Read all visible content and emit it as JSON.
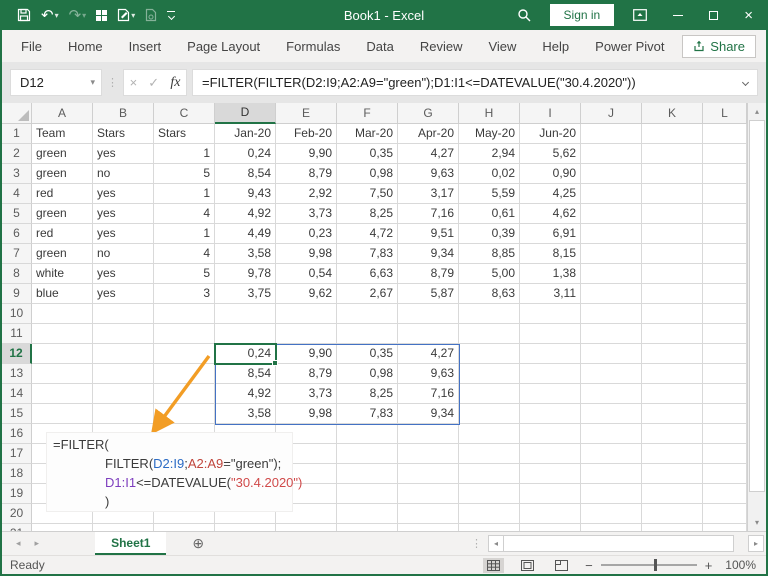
{
  "window": {
    "title": "Book1  -  Excel",
    "sign_in": "Sign in"
  },
  "colors": {
    "excel_green": "#217346",
    "spill_border": "#4472C4",
    "arrow_orange": "#F29D25",
    "gridline": "#D9D9D9"
  },
  "icons": {
    "quick_access": [
      "save",
      "undo",
      "redo",
      "grid-squares",
      "paste-edit",
      "document",
      "customize-toolbar"
    ],
    "titlebar_right": [
      "search",
      "ribbon-display-options",
      "minimize",
      "maximize",
      "close"
    ],
    "formula_bar": [
      "cancel",
      "enter",
      "insert-function",
      "expand-formula-bar"
    ],
    "status_views": [
      "normal-view",
      "page-layout-view",
      "page-break-view"
    ]
  },
  "ribbon": {
    "tabs": [
      "File",
      "Home",
      "Insert",
      "Page Layout",
      "Formulas",
      "Data",
      "Review",
      "View",
      "Help",
      "Power Pivot"
    ],
    "share": "Share"
  },
  "formula_bar": {
    "name_box": "D12",
    "formula": "=FILTER(FILTER(D2:I9;A2:A9=\"green\");D1:I1<=DATEVALUE(\"30.4.2020\"))"
  },
  "sheet": {
    "columns": [
      "A",
      "B",
      "C",
      "D",
      "E",
      "F",
      "G",
      "H",
      "I",
      "J",
      "K",
      "L"
    ],
    "visible_rows": 21,
    "selected_cell": {
      "col": "D",
      "row": 12
    },
    "spill_range": "D12:G15",
    "rows": [
      {
        "n": 1,
        "cells": [
          [
            "A",
            "Team",
            "l"
          ],
          [
            "B",
            "Stars",
            "l"
          ],
          [
            "C",
            "Stars",
            "l"
          ],
          [
            "D",
            "Jan-20",
            "r"
          ],
          [
            "E",
            "Feb-20",
            "r"
          ],
          [
            "F",
            "Mar-20",
            "r"
          ],
          [
            "G",
            "Apr-20",
            "r"
          ],
          [
            "H",
            "May-20",
            "r"
          ],
          [
            "I",
            "Jun-20",
            "r"
          ]
        ]
      },
      {
        "n": 2,
        "cells": [
          [
            "A",
            "green",
            "l"
          ],
          [
            "B",
            "yes",
            "l"
          ],
          [
            "C",
            "1",
            "r"
          ],
          [
            "D",
            "0,24",
            "r"
          ],
          [
            "E",
            "9,90",
            "r"
          ],
          [
            "F",
            "0,35",
            "r"
          ],
          [
            "G",
            "4,27",
            "r"
          ],
          [
            "H",
            "2,94",
            "r"
          ],
          [
            "I",
            "5,62",
            "r"
          ]
        ]
      },
      {
        "n": 3,
        "cells": [
          [
            "A",
            "green",
            "l"
          ],
          [
            "B",
            "no",
            "l"
          ],
          [
            "C",
            "5",
            "r"
          ],
          [
            "D",
            "8,54",
            "r"
          ],
          [
            "E",
            "8,79",
            "r"
          ],
          [
            "F",
            "0,98",
            "r"
          ],
          [
            "G",
            "9,63",
            "r"
          ],
          [
            "H",
            "0,02",
            "r"
          ],
          [
            "I",
            "0,90",
            "r"
          ]
        ]
      },
      {
        "n": 4,
        "cells": [
          [
            "A",
            "red",
            "l"
          ],
          [
            "B",
            "yes",
            "l"
          ],
          [
            "C",
            "1",
            "r"
          ],
          [
            "D",
            "9,43",
            "r"
          ],
          [
            "E",
            "2,92",
            "r"
          ],
          [
            "F",
            "7,50",
            "r"
          ],
          [
            "G",
            "3,17",
            "r"
          ],
          [
            "H",
            "5,59",
            "r"
          ],
          [
            "I",
            "4,25",
            "r"
          ]
        ]
      },
      {
        "n": 5,
        "cells": [
          [
            "A",
            "green",
            "l"
          ],
          [
            "B",
            "yes",
            "l"
          ],
          [
            "C",
            "4",
            "r"
          ],
          [
            "D",
            "4,92",
            "r"
          ],
          [
            "E",
            "3,73",
            "r"
          ],
          [
            "F",
            "8,25",
            "r"
          ],
          [
            "G",
            "7,16",
            "r"
          ],
          [
            "H",
            "0,61",
            "r"
          ],
          [
            "I",
            "4,62",
            "r"
          ]
        ]
      },
      {
        "n": 6,
        "cells": [
          [
            "A",
            "red",
            "l"
          ],
          [
            "B",
            "yes",
            "l"
          ],
          [
            "C",
            "1",
            "r"
          ],
          [
            "D",
            "4,49",
            "r"
          ],
          [
            "E",
            "0,23",
            "r"
          ],
          [
            "F",
            "4,72",
            "r"
          ],
          [
            "G",
            "9,51",
            "r"
          ],
          [
            "H",
            "0,39",
            "r"
          ],
          [
            "I",
            "6,91",
            "r"
          ]
        ]
      },
      {
        "n": 7,
        "cells": [
          [
            "A",
            "green",
            "l"
          ],
          [
            "B",
            "no",
            "l"
          ],
          [
            "C",
            "4",
            "r"
          ],
          [
            "D",
            "3,58",
            "r"
          ],
          [
            "E",
            "9,98",
            "r"
          ],
          [
            "F",
            "7,83",
            "r"
          ],
          [
            "G",
            "9,34",
            "r"
          ],
          [
            "H",
            "8,85",
            "r"
          ],
          [
            "I",
            "8,15",
            "r"
          ]
        ]
      },
      {
        "n": 8,
        "cells": [
          [
            "A",
            "white",
            "l"
          ],
          [
            "B",
            "yes",
            "l"
          ],
          [
            "C",
            "5",
            "r"
          ],
          [
            "D",
            "9,78",
            "r"
          ],
          [
            "E",
            "0,54",
            "r"
          ],
          [
            "F",
            "6,63",
            "r"
          ],
          [
            "G",
            "8,79",
            "r"
          ],
          [
            "H",
            "5,00",
            "r"
          ],
          [
            "I",
            "1,38",
            "r"
          ]
        ]
      },
      {
        "n": 9,
        "cells": [
          [
            "A",
            "blue",
            "l"
          ],
          [
            "B",
            "yes",
            "l"
          ],
          [
            "C",
            "3",
            "r"
          ],
          [
            "D",
            "3,75",
            "r"
          ],
          [
            "E",
            "9,62",
            "r"
          ],
          [
            "F",
            "2,67",
            "r"
          ],
          [
            "G",
            "5,87",
            "r"
          ],
          [
            "H",
            "8,63",
            "r"
          ],
          [
            "I",
            "3,11",
            "r"
          ]
        ]
      },
      {
        "n": 12,
        "cells": [
          [
            "D",
            "0,24",
            "r"
          ],
          [
            "E",
            "9,90",
            "r"
          ],
          [
            "F",
            "0,35",
            "r"
          ],
          [
            "G",
            "4,27",
            "r"
          ]
        ]
      },
      {
        "n": 13,
        "cells": [
          [
            "D",
            "8,54",
            "r"
          ],
          [
            "E",
            "8,79",
            "r"
          ],
          [
            "F",
            "0,98",
            "r"
          ],
          [
            "G",
            "9,63",
            "r"
          ]
        ]
      },
      {
        "n": 14,
        "cells": [
          [
            "D",
            "4,92",
            "r"
          ],
          [
            "E",
            "3,73",
            "r"
          ],
          [
            "F",
            "8,25",
            "r"
          ],
          [
            "G",
            "7,16",
            "r"
          ]
        ]
      },
      {
        "n": 15,
        "cells": [
          [
            "D",
            "3,58",
            "r"
          ],
          [
            "E",
            "9,98",
            "r"
          ],
          [
            "F",
            "7,83",
            "r"
          ],
          [
            "G",
            "9,34",
            "r"
          ]
        ]
      }
    ]
  },
  "annotation": {
    "colors": {
      "k": "#3b3b3b",
      "b": "#2B6BC4",
      "r": "#C0453C",
      "p": "#7D3DBE",
      "c": "#D04A4A"
    },
    "lines": [
      {
        "indent": 0,
        "segments": [
          {
            "t": "=FILTER(",
            "c": "k"
          }
        ]
      },
      {
        "indent": 1,
        "segments": [
          {
            "t": "FILTER(",
            "c": "k"
          },
          {
            "t": "D2:I9",
            "c": "b"
          },
          {
            "t": ";",
            "c": "k"
          },
          {
            "t": "A2:A9",
            "c": "r"
          },
          {
            "t": "=\"green\");",
            "c": "k"
          }
        ]
      },
      {
        "indent": 1,
        "segments": [
          {
            "t": "D1:I1",
            "c": "p"
          },
          {
            "t": "<=DATEVALUE(",
            "c": "k"
          },
          {
            "t": "\"30.4.2020\")",
            "c": "c"
          }
        ]
      },
      {
        "indent": 1,
        "segments": [
          {
            "t": ")",
            "c": "k"
          }
        ]
      }
    ]
  },
  "sheet_tabs": {
    "active": "Sheet1"
  },
  "status_bar": {
    "mode": "Ready",
    "zoom": "100%"
  }
}
